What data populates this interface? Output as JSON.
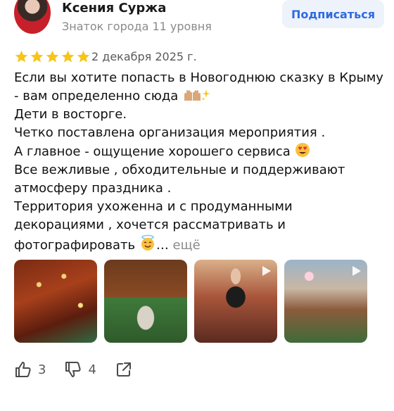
{
  "author": {
    "name": "Ксения Суржа",
    "level": "Знаток города 11 уровня"
  },
  "subscribe_label": "Подписаться",
  "review": {
    "rating": 5,
    "max_rating": 5,
    "date": "2 декабря 2025 г.",
    "lines": [
      "Если вы хотите попасть в Новогоднюю сказку в Крыму",
      "- вам определенно сюда",
      "Дети в восторге.",
      "Четко поставлена организация мероприятия .",
      "А главное - ощущение хорошего сервиса",
      "Все вежливые , обходительные и поддерживают",
      "атмосферу праздника .",
      "Территория ухоженна и с продуманными",
      "декорациями , хочется рассматривать и",
      "фотографировать"
    ],
    "ellipsis": "…",
    "more_label": "ещё"
  },
  "photos": [
    {
      "name": "photo-1",
      "has_play": false
    },
    {
      "name": "photo-2",
      "has_play": false
    },
    {
      "name": "photo-3",
      "has_play": true
    },
    {
      "name": "photo-4",
      "has_play": true
    }
  ],
  "actions": {
    "likes": "3",
    "dislikes": "4",
    "icons": [
      "thumbs-up-icon",
      "thumbs-down-icon",
      "share-icon"
    ]
  },
  "colors": {
    "accent": "#2d6be0",
    "star": "#f5c518",
    "muted": "#8a8a8a"
  }
}
